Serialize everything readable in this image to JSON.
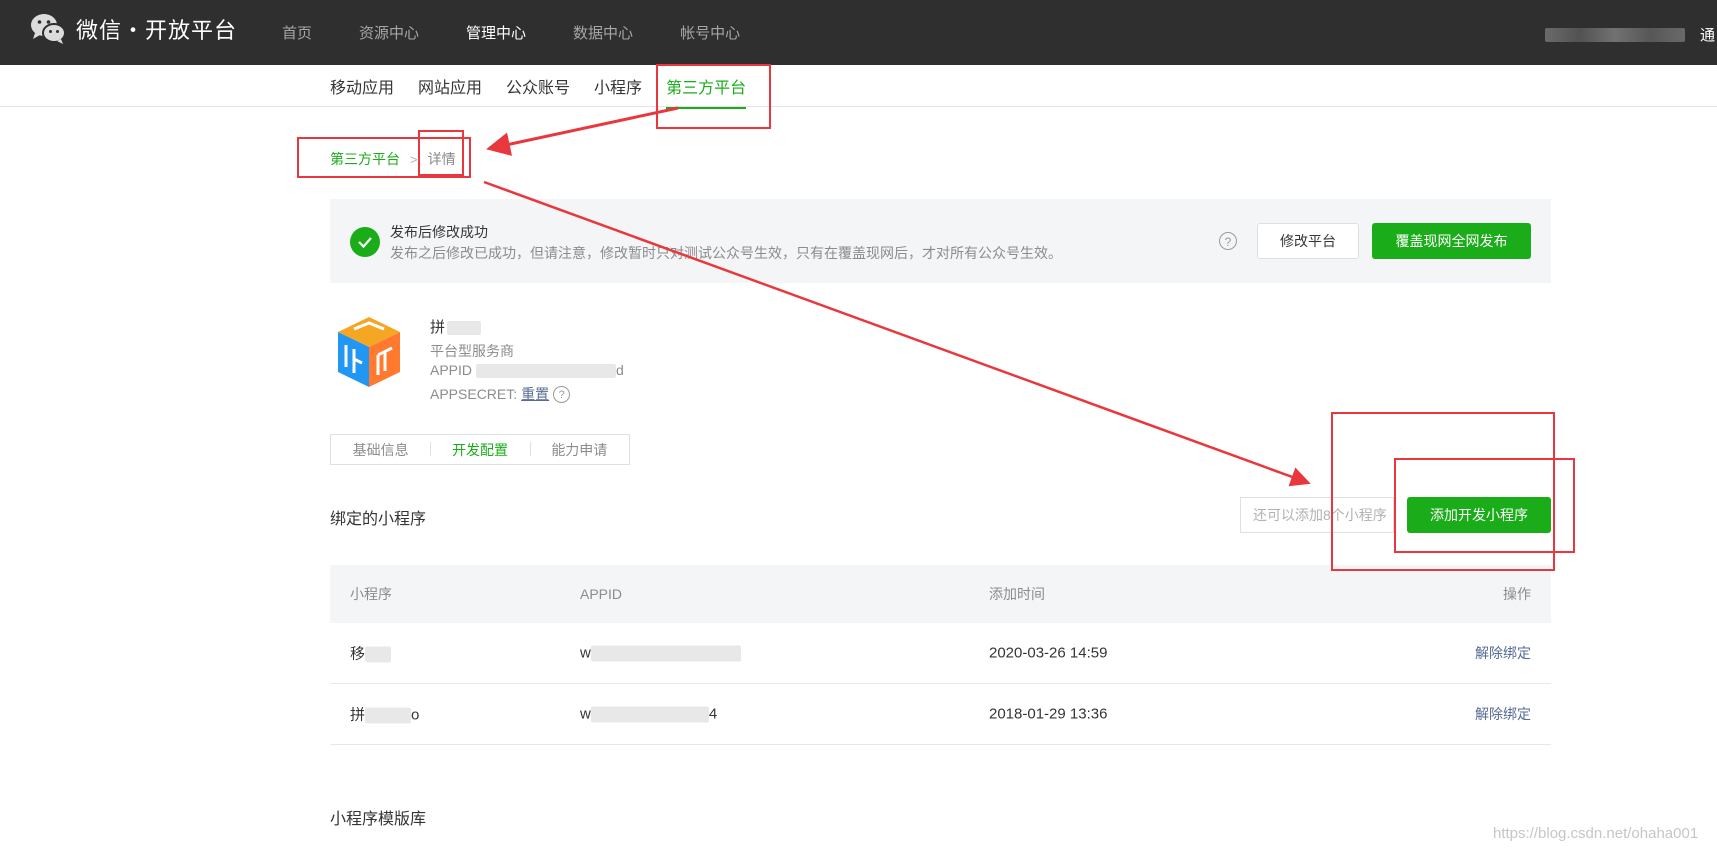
{
  "header": {
    "brand": "微信・开放平台",
    "nav": [
      "首页",
      "资源中心",
      "管理中心",
      "数据中心",
      "帐号中心"
    ],
    "user_name": "通"
  },
  "subnav": [
    "移动应用",
    "网站应用",
    "公众账号",
    "小程序",
    "第三方平台"
  ],
  "breadcrumb": {
    "parent": "第三方平台",
    "separator": ">",
    "current": "详情"
  },
  "notice": {
    "title": "发布后修改成功",
    "desc": "发布之后修改已成功，但请注意，修改暂时只对测试公众号生效，只有在覆盖现网后，才对所有公众号生效。",
    "help": "?",
    "edit_button": "修改平台",
    "publish_button": "覆盖现网全网发布"
  },
  "app": {
    "name": "拼",
    "type": "平台型服务商",
    "appid_label": "APPID",
    "appid_tail": "d",
    "secret_label": "APPSECRET:",
    "reset": "重置",
    "help": "?"
  },
  "tabs": [
    "基础信息",
    "开发配置",
    "能力申请"
  ],
  "bound": {
    "title": "绑定的小程序",
    "search_placeholder": "还可以添加8个小程序",
    "add_button": "添加开发小程序",
    "columns": [
      "小程序",
      "APPID",
      "添加时间",
      "操作"
    ],
    "rows": [
      {
        "name": "移",
        "appid": "w",
        "time": "2020-03-26 14:59",
        "action": "解除绑定"
      },
      {
        "name": "拼",
        "name_tail": "o",
        "appid": "w",
        "appid_tail": "4",
        "time": "2018-01-29 13:36",
        "action": "解除绑定"
      }
    ]
  },
  "template_title": "小程序模版库",
  "watermark": "https://blog.csdn.net/ohaha001",
  "colors": {
    "brand_green": "#1aad19",
    "link": "#576b95",
    "annotation_red": "#e8383d",
    "topbar": "#2f2f2f"
  }
}
